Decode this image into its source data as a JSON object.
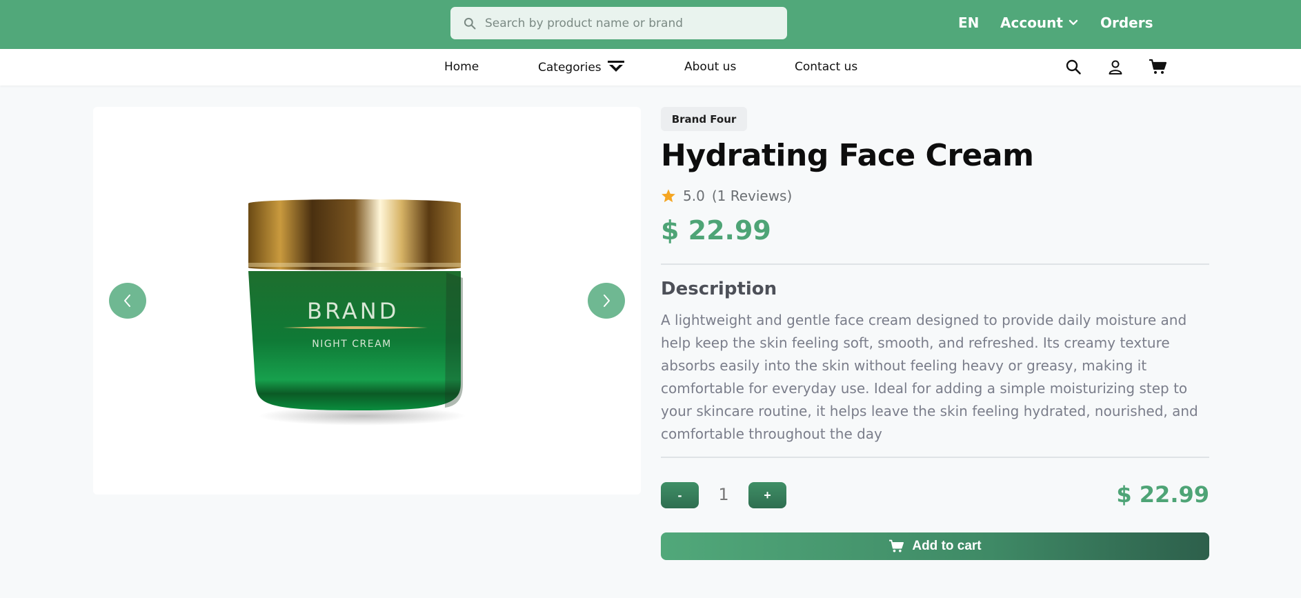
{
  "header": {
    "search_placeholder": "Search by product name or brand",
    "language": "EN",
    "account_label": "Account",
    "orders_label": "Orders"
  },
  "nav": {
    "home": "Home",
    "categories": "Categories",
    "about": "About us",
    "contact": "Contact us"
  },
  "product": {
    "brand": "Brand Four",
    "name": "Hydrating Face Cream",
    "rating": "5.0",
    "reviews": "(1 Reviews)",
    "price": "$ 22.99",
    "description_heading": "Description",
    "description": "A lightweight and gentle face cream designed to provide daily moisture and help keep the skin feeling soft, smooth, and refreshed. Its creamy texture absorbs easily into the skin without feeling heavy or greasy, making it comfortable for everyday use. Ideal for adding a simple moisturizing step to your skincare routine, it helps leave the skin feeling hydrated, nourished, and comfortable throughout the day",
    "jar_brand": "BRAND",
    "jar_type": "NIGHT CREAM"
  },
  "purchase": {
    "minus": "-",
    "quantity": "1",
    "plus": "+",
    "line_total": "$ 22.99",
    "add_to_cart": "Add to cart"
  },
  "colors": {
    "brand_green": "#51a87a",
    "price_green": "#4ea476",
    "star": "#f5a623"
  }
}
